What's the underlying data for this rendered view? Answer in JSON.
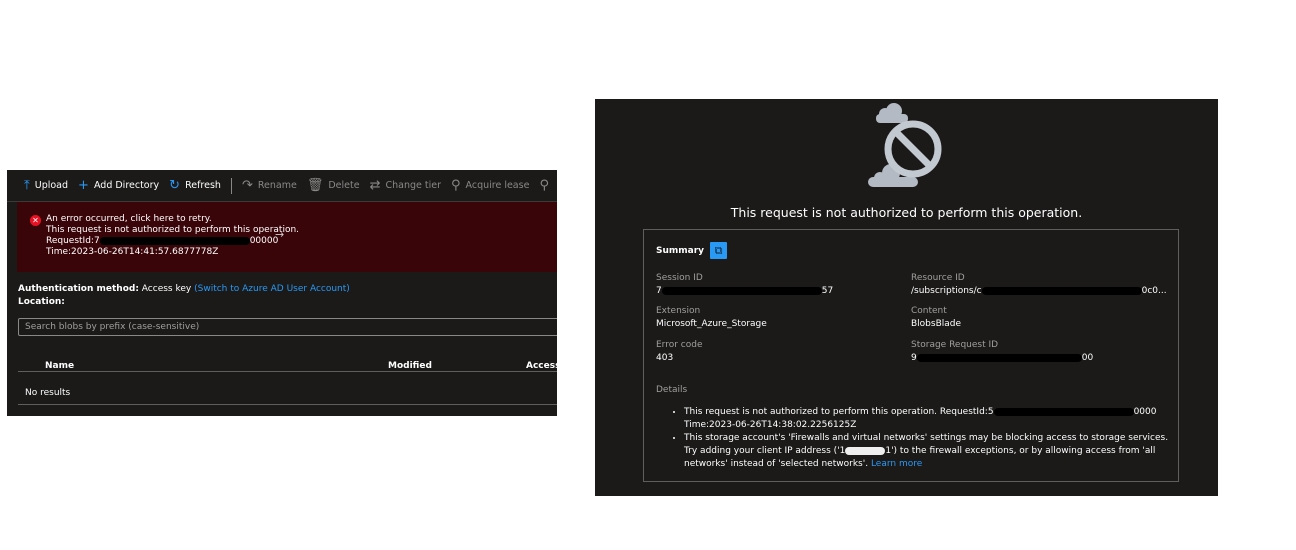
{
  "storage_browser": {
    "toolbar": [
      {
        "label": "Upload",
        "icon": "upload-arrow-icon",
        "enabled": true
      },
      {
        "label": "Add Directory",
        "icon": "plus-icon",
        "enabled": true
      },
      {
        "label": "Refresh",
        "icon": "refresh-icon",
        "enabled": true
      },
      {
        "label": "Rename",
        "icon": "rename-icon",
        "enabled": false
      },
      {
        "label": "Delete",
        "icon": "trash-icon",
        "enabled": false
      },
      {
        "label": "Change tier",
        "icon": "swap-arrows-icon",
        "enabled": false
      },
      {
        "label": "Acquire lease",
        "icon": "link-icon",
        "enabled": false
      }
    ],
    "error": {
      "line1": "An error occurred, click here to retry.",
      "line2": "This request is not authorized to perform this operation.",
      "request_prefix": "RequestId:7",
      "request_suffix": "00000",
      "time": "Time:2023-06-26T14:41:57.6877778Z"
    },
    "auth_label": "Authentication method:",
    "auth_value": "Access key",
    "auth_link": "(Switch to Azure AD User Account)",
    "location_label": "Location:",
    "search_placeholder": "Search blobs by prefix (case-sensitive)",
    "columns": [
      "Name",
      "Modified",
      "Access"
    ],
    "empty": "No results"
  },
  "error_blade": {
    "title": "This request is not authorized to perform this operation.",
    "summary_label": "Summary",
    "fields": {
      "session_id": {
        "label": "Session ID",
        "prefix": "7",
        "suffix": "57"
      },
      "resource_id": {
        "label": "Resource ID",
        "prefix": "/subscriptions/c",
        "suffix": "0c0..."
      },
      "extension": {
        "label": "Extension",
        "value": "Microsoft_Azure_Storage"
      },
      "content": {
        "label": "Content",
        "value": "BlobsBlade"
      },
      "error_code": {
        "label": "Error code",
        "value": "403"
      },
      "storage_request_id": {
        "label": "Storage Request ID",
        "prefix": "9",
        "suffix": "00"
      }
    },
    "details_label": "Details",
    "detail1_prefix": "This request is not authorized to perform this operation. RequestId:5",
    "detail1_suffix": "0000",
    "detail1_time": "Time:2023-06-26T14:38:02.2256125Z",
    "detail2_a": "This storage account's 'Firewalls and virtual networks' settings may be blocking access to storage services. Try adding your client IP address ('1",
    "detail2_b": "1') to the firewall exceptions, or by allowing access from 'all networks' instead of 'selected networks'.",
    "learn_more": "Learn more"
  }
}
